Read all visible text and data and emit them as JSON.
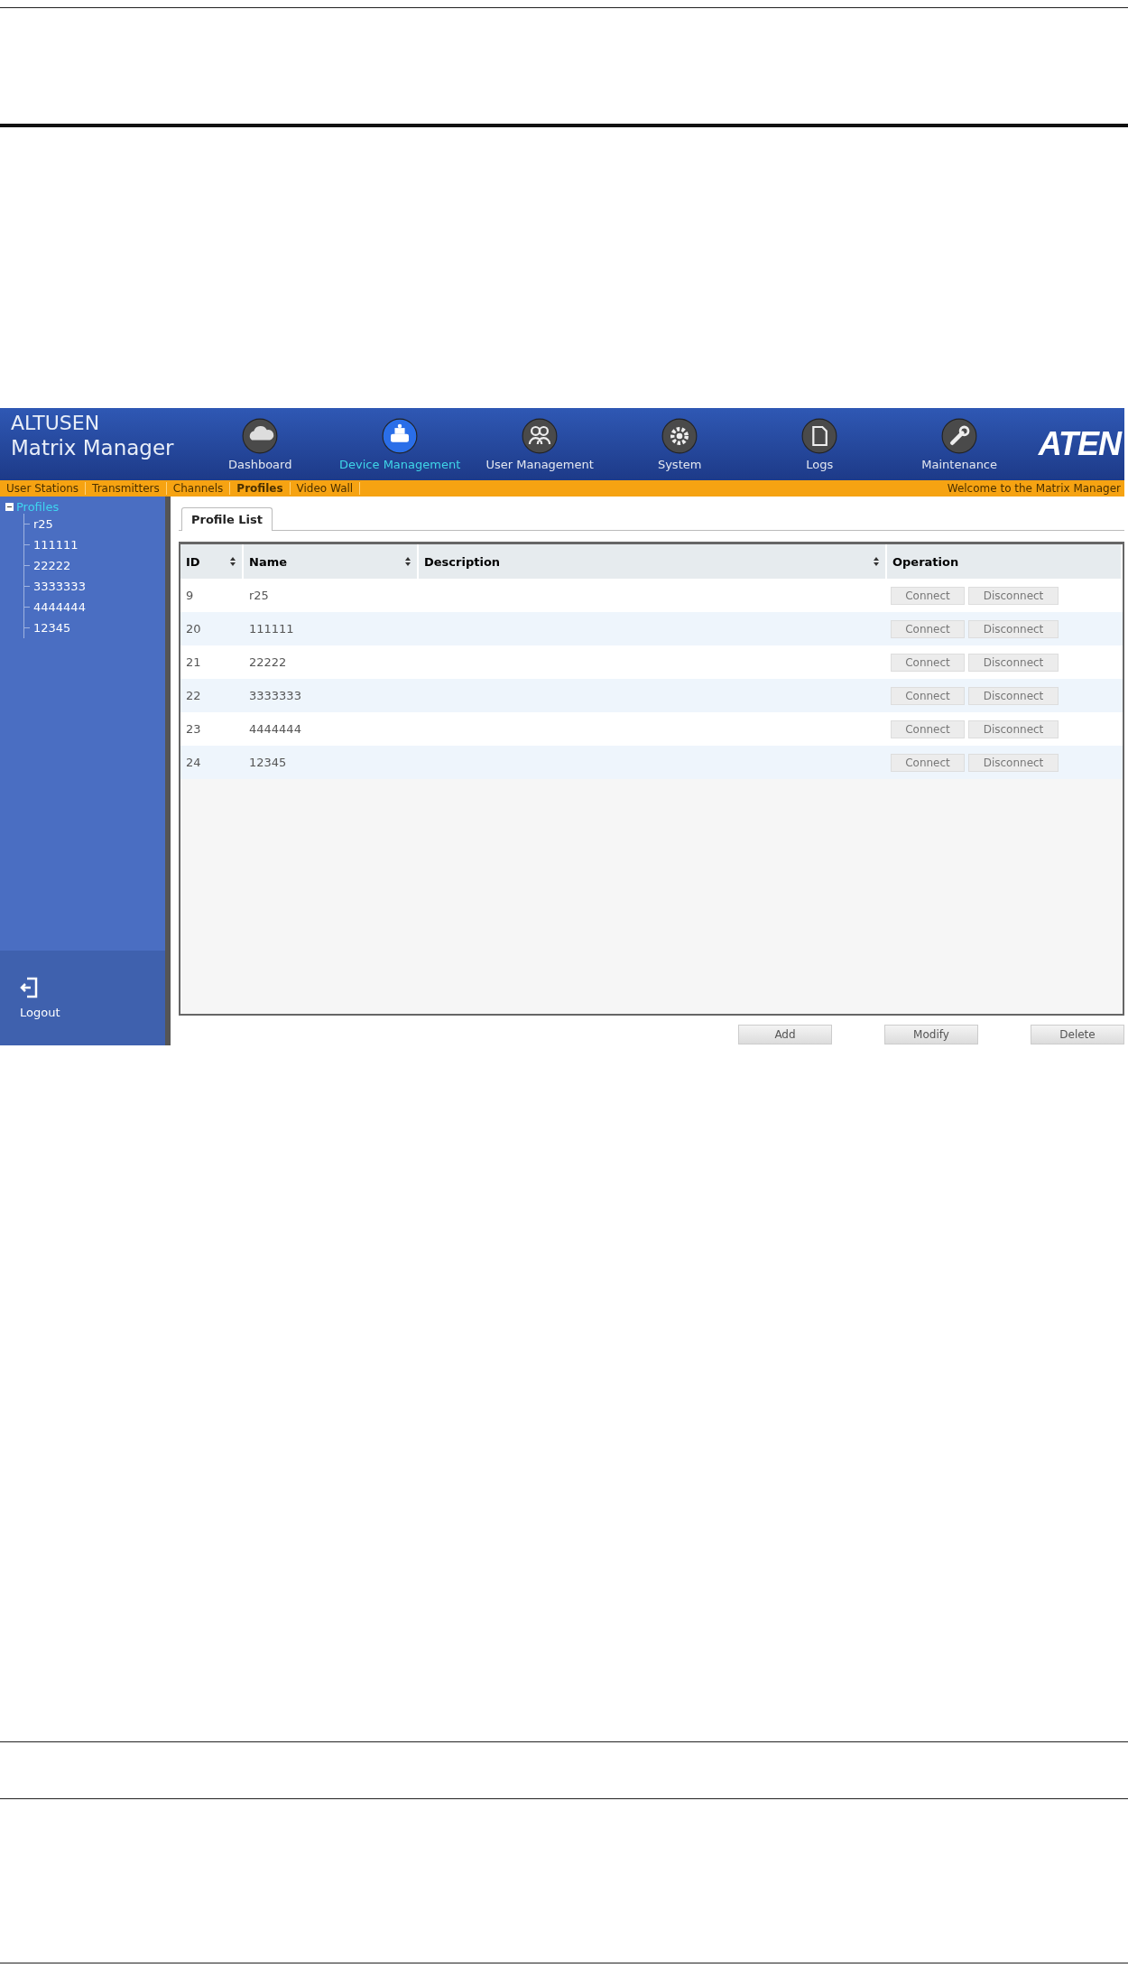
{
  "app": {
    "brand_line1": "ALTUSEN",
    "brand_line2": "Matrix Manager",
    "logo": "ATEN"
  },
  "nav": [
    {
      "label": "Dashboard",
      "selected": false
    },
    {
      "label": "Device Management",
      "selected": true
    },
    {
      "label": "User Management",
      "selected": false
    },
    {
      "label": "System",
      "selected": false
    },
    {
      "label": "Logs",
      "selected": false
    },
    {
      "label": "Maintenance",
      "selected": false
    }
  ],
  "subnav": [
    {
      "label": "User Stations",
      "selected": false
    },
    {
      "label": "Transmitters",
      "selected": false
    },
    {
      "label": "Channels",
      "selected": false
    },
    {
      "label": "Profiles",
      "selected": true
    },
    {
      "label": "Video Wall",
      "selected": false
    }
  ],
  "welcome": "Welcome to the Matrix Manager",
  "sidebar": {
    "tree": {
      "label": "Profiles",
      "expanded": true,
      "selected": true,
      "children": [
        {
          "label": "r25",
          "selected": false
        },
        {
          "label": "111111",
          "selected": false
        },
        {
          "label": "22222",
          "selected": false
        },
        {
          "label": "3333333",
          "selected": false
        },
        {
          "label": "4444444",
          "selected": false
        },
        {
          "label": "12345",
          "selected": false
        }
      ]
    },
    "logout": "Logout"
  },
  "tabs": [
    {
      "label": "Profile List",
      "selected": true
    }
  ],
  "table": {
    "columns": [
      {
        "label": "ID",
        "sortable": true
      },
      {
        "label": "Name",
        "sortable": true
      },
      {
        "label": "Description",
        "sortable": true
      },
      {
        "label": "Operation",
        "sortable": false
      }
    ],
    "rows": [
      {
        "id": "9",
        "name": "r25",
        "actions": [
          "Connect",
          "Disconnect"
        ]
      },
      {
        "id": "20",
        "name": "111111",
        "actions": [
          "Connect",
          "Disconnect"
        ]
      },
      {
        "id": "21",
        "name": "22222",
        "actions": [
          "Connect",
          "Disconnect"
        ]
      },
      {
        "id": "22",
        "name": "3333333",
        "actions": [
          "Connect",
          "Disconnect"
        ]
      },
      {
        "id": "23",
        "name": "4444444",
        "actions": [
          "Connect",
          "Disconnect"
        ]
      },
      {
        "id": "24",
        "name": "12345",
        "actions": [
          "Connect",
          "Disconnect"
        ]
      }
    ]
  },
  "buttons": [
    "Add",
    "Modify",
    "Delete"
  ]
}
